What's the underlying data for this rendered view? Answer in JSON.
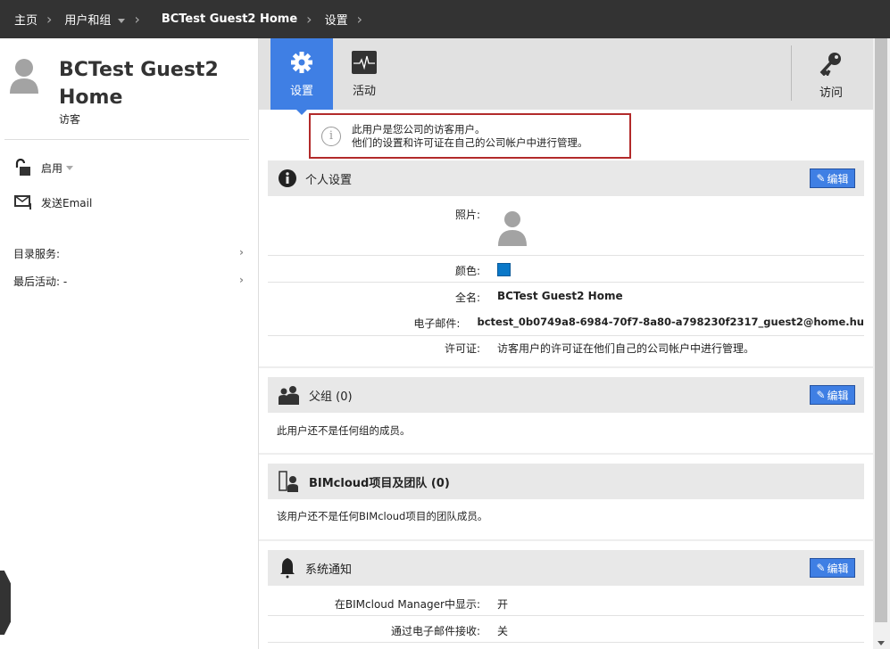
{
  "breadcrumb": {
    "home": "主页",
    "users": "用户和组",
    "user": "BCTest Guest2 Home",
    "settings": "设置"
  },
  "user": {
    "name": "BCTest Guest2 Home",
    "role": "访客"
  },
  "left": {
    "status": "启用",
    "send_email": "发送Email",
    "directory": "目录服务:",
    "last_activity": "最后活动: -"
  },
  "tabs": {
    "settings": "设置",
    "activity": "活动",
    "access": "访问"
  },
  "notice": {
    "line1": "此用户是您公司的访客用户。",
    "line2": "他们的设置和许可证在自己的公司帐户中进行管理。"
  },
  "edit_label": "编辑",
  "personal": {
    "title": "个人设置",
    "photo_label": "照片:",
    "color_label": "颜色:",
    "color": "#0a78c8",
    "fullname_label": "全名:",
    "fullname": "BCTest Guest2 Home",
    "email_label": "电子邮件:",
    "email": "bctest_0b0749a8-6984-70f7-8a80-a798230f2317_guest2@home.hu",
    "license_label": "许可证:",
    "license": "访客用户的许可证在他们自己的公司帐户中进行管理。"
  },
  "groups": {
    "title": "父组 (0)",
    "empty": "此用户还不是任何组的成员。"
  },
  "projects": {
    "title": "BIMcloud项目及团队 (0)",
    "empty": "该用户还不是任何BIMcloud项目的团队成员。"
  },
  "notifications": {
    "title": "系统通知",
    "show_label": "在BIMcloud Manager中显示:",
    "show_value": "开",
    "email_label": "通过电子邮件接收:",
    "email_value": "关"
  }
}
